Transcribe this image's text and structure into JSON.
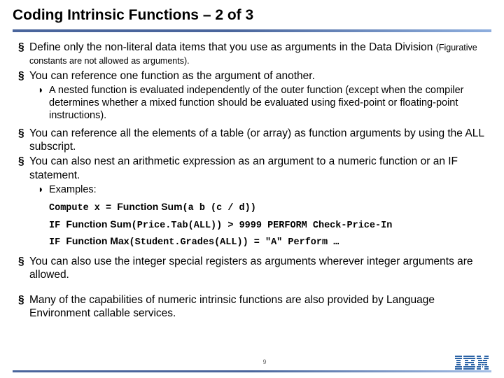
{
  "title": "Coding Intrinsic Functions – 2 of 3",
  "bullets": {
    "b1": "Define only the non-literal data items that you use as arguments in the Data Division ",
    "b1paren": "(Figurative constants are not allowed as arguments).",
    "b2": "You can reference one function as the argument of another.",
    "b2sub": "A nested function is evaluated independently of the outer function (except when the compiler determines whether a mixed function should be evaluated using fixed-point or floating-point instructions).",
    "b3": "You can reference all the elements of a table (or array) as function arguments by using the ALL subscript.",
    "b4": "You can also nest an arithmetic expression as an argument to a numeric function or an IF statement.",
    "b4sub": "Examples:",
    "b5": "You can also use the integer special registers as arguments wherever integer arguments are allowed.",
    "b6": "Many of the capabilities of numeric intrinsic functions are also provided by Language Environment callable services."
  },
  "code": {
    "l1a": "Compute x = ",
    "l1b": "Function Sum",
    "l1c": "(a b (c / d))",
    "l2a": "IF ",
    "l2b": "Function Sum",
    "l2c": "(Price.Tab(ALL)) > 9999 PERFORM Check-Price-In",
    "l3a": "IF ",
    "l3b": "Function Max",
    "l3c": "(Student.Grades(ALL)) = \"A\" Perform …"
  },
  "pageNumber": "9",
  "logoName": "ibm-logo"
}
